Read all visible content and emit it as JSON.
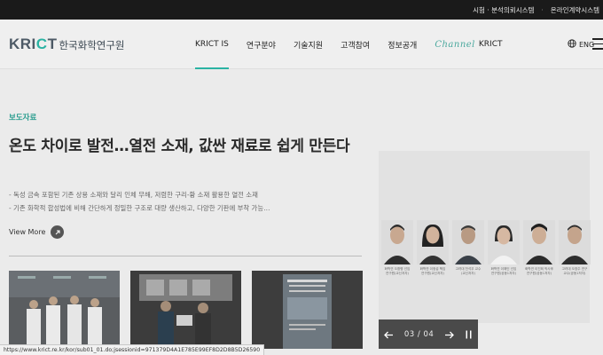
{
  "topbar": {
    "links": [
      "시험 · 분석의뢰시스템",
      "·",
      "온라인계약시스템"
    ]
  },
  "header": {
    "logo_en_pre": "KRI",
    "logo_en_accent": "C",
    "logo_en_post": "T",
    "logo_ko": "한국화학연구원",
    "nav": [
      "KRICT IS",
      "연구분야",
      "기술지원",
      "고객참여",
      "정보공개"
    ],
    "channel_script": "Channel",
    "channel_label": "KRICT",
    "lang": "ENG"
  },
  "main": {
    "badge": "보도자료",
    "headline": "온도 차이로 발전…열전 소재, 값싼 재료로 쉽게 만든다",
    "bullets": [
      "- 독성 금속 포함된 기존 상용 소재와 달리 인체 무해, 저렴한 구리-황 소재 활용한 열전 소재",
      "- 기존 화학적 합성법에 비해 간단하게 정밀한 구조로 대량 생산하고, 다양한 기판에 부착 가능…"
    ],
    "view_more": "View More"
  },
  "slider": {
    "current": "03",
    "separator": "/",
    "total": "04",
    "people": [
      {
        "line1": "화학연 오환병 선임",
        "line2": "연구원(교신저자)"
      },
      {
        "line1": "화학연 이정섭 책임",
        "line2": "연구원(교신저자)"
      },
      {
        "line1": "고려대 천석우 교수",
        "line2": "(교신저자)"
      },
      {
        "line1": "화학연 이해인 선임",
        "line2": "연구원(공동1저자)"
      },
      {
        "line1": "화학연 이진희 박사후",
        "line2": "연구원(공동1저자)"
      },
      {
        "line1": "고려대 오창주 연구",
        "line2": "교수(공동1저자)"
      }
    ]
  },
  "statusbar": {
    "url": "https://www.krict.re.kr/kor/sub01_01.do;jsessionid=971379D4A1E785E99EF8D2D8B5D26590"
  }
}
